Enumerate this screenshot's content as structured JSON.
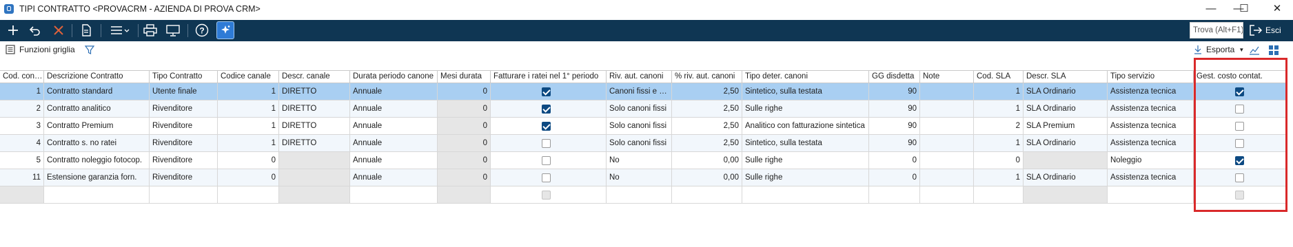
{
  "window": {
    "title": "TIPI CONTRATTO <PROVACRM - AZIENDA DI PROVA CRM>",
    "minimize": "—",
    "maximize": "☐",
    "close": "✕"
  },
  "toolbar": {
    "find_placeholder": "Trova (Alt+F1)",
    "exit_label": "Esci",
    "colors": {
      "background": "#0f3653"
    }
  },
  "subbar": {
    "grid_functions": "Funzioni griglia",
    "export": "Esporta"
  },
  "grid": {
    "columns": [
      "Cod. contratto",
      "Descrizione Contratto",
      "Tipo Contratto",
      "Codice canale",
      "Descr. canale",
      "Durata periodo canone",
      "Mesi durata",
      "Fatturare i ratei nel 1° periodo",
      "Riv. aut. canoni",
      "% riv. aut. canoni",
      "Tipo deter. canoni",
      "GG disdetta",
      "Note",
      "Cod. SLA",
      "Descr. SLA",
      "Tipo servizio",
      "Gest. costo contat."
    ],
    "rows": [
      {
        "cod": "1",
        "descr": "Contratto standard",
        "tipo": "Utente finale",
        "codcanale": "1",
        "descrcanale": "DIRETTO",
        "durata": "Annuale",
        "mesi": "0",
        "fatt": true,
        "riv": "Canoni fissi e co...",
        "perc": "2,50",
        "deter": "Sintetico, sulla testata",
        "gg": "90",
        "note": "",
        "sla": "1",
        "descrsla": "SLA Ordinario",
        "servizio": "Assistenza tecnica",
        "gest": true
      },
      {
        "cod": "2",
        "descr": "Contratto analitico",
        "tipo": "Rivenditore",
        "codcanale": "1",
        "descrcanale": "DIRETTO",
        "durata": "Annuale",
        "mesi": "0",
        "fatt": true,
        "riv": "Solo canoni fissi",
        "perc": "2,50",
        "deter": "Sulle righe",
        "gg": "90",
        "note": "",
        "sla": "1",
        "descrsla": "SLA Ordinario",
        "servizio": "Assistenza tecnica",
        "gest": false
      },
      {
        "cod": "3",
        "descr": "Contratto Premium",
        "tipo": "Rivenditore",
        "codcanale": "1",
        "descrcanale": "DIRETTO",
        "durata": "Annuale",
        "mesi": "0",
        "fatt": true,
        "riv": "Solo canoni fissi",
        "perc": "2,50",
        "deter": "Analitico con fatturazione sintetica",
        "gg": "90",
        "note": "",
        "sla": "2",
        "descrsla": "SLA Premium",
        "servizio": "Assistenza tecnica",
        "gest": false
      },
      {
        "cod": "4",
        "descr": "Contratto s. no ratei",
        "tipo": "Rivenditore",
        "codcanale": "1",
        "descrcanale": "DIRETTO",
        "durata": "Annuale",
        "mesi": "0",
        "fatt": false,
        "riv": "Solo canoni fissi",
        "perc": "2,50",
        "deter": "Sintetico, sulla testata",
        "gg": "90",
        "note": "",
        "sla": "1",
        "descrsla": "SLA Ordinario",
        "servizio": "Assistenza tecnica",
        "gest": false
      },
      {
        "cod": "5",
        "descr": "Contratto noleggio fotocop.",
        "tipo": "Rivenditore",
        "codcanale": "0",
        "descrcanale": "",
        "durata": "Annuale",
        "mesi": "0",
        "fatt": false,
        "riv": "No",
        "perc": "0,00",
        "deter": "Sulle righe",
        "gg": "0",
        "note": "",
        "sla": "0",
        "descrsla": "",
        "servizio": "Noleggio",
        "gest": true
      },
      {
        "cod": "11",
        "descr": "Estensione garanzia forn.",
        "tipo": "Rivenditore",
        "codcanale": "0",
        "descrcanale": "",
        "durata": "Annuale",
        "mesi": "0",
        "fatt": false,
        "riv": "No",
        "perc": "0,00",
        "deter": "Sulle righe",
        "gg": "0",
        "note": "",
        "sla": "1",
        "descrsla": "SLA Ordinario",
        "servizio": "Assistenza tecnica",
        "gest": false
      }
    ],
    "colors": {
      "selected_row": "#a9cff2",
      "alt_row": "#f2f7fc",
      "highlight_border": "#d9292a"
    }
  }
}
